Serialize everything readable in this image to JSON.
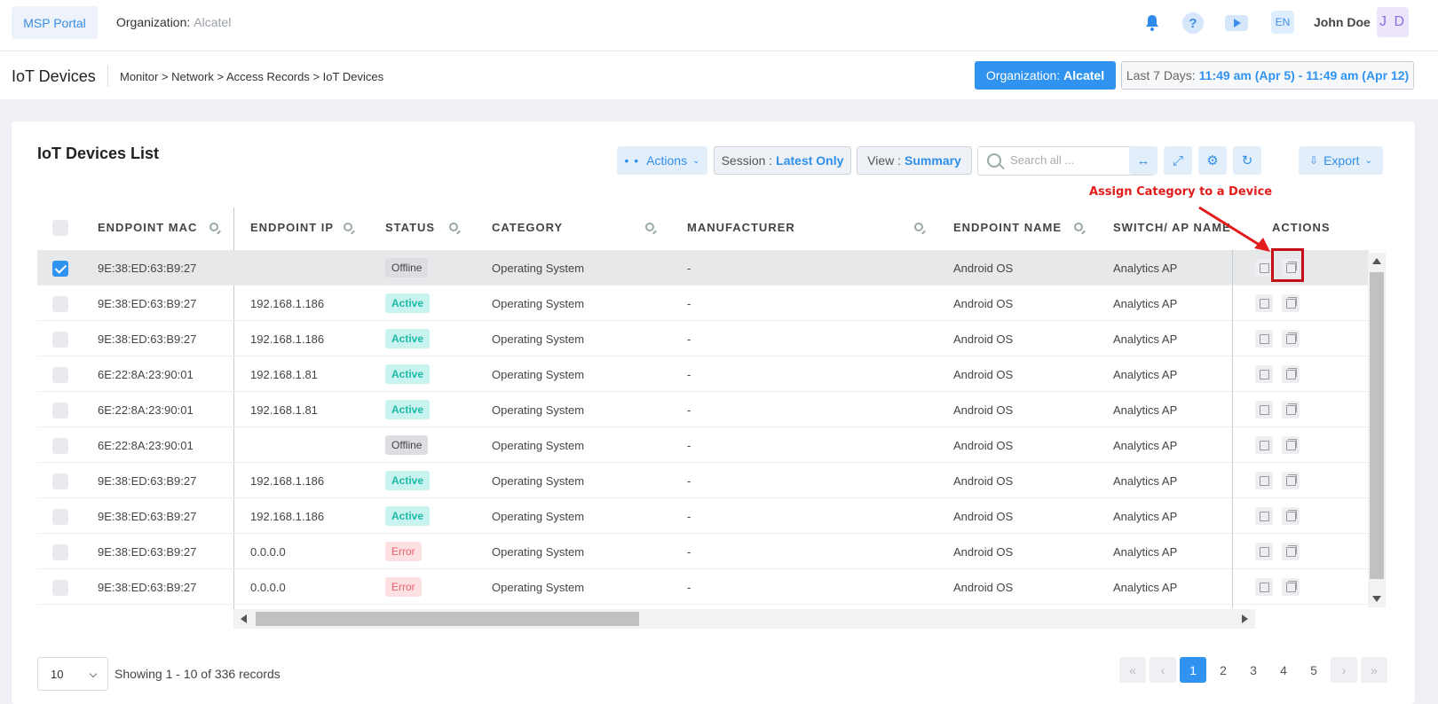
{
  "topbar": {
    "msp_portal": "MSP Portal",
    "org_label": "Organization:",
    "org_value": "Alcatel",
    "lang": "EN",
    "user_name": "John Doe",
    "avatar_initials": "J D"
  },
  "subheader": {
    "title": "IoT Devices",
    "breadcrumb": "Monitor > Network > Access Records > IoT Devices",
    "org_pill_label": "Organization:",
    "org_pill_value": "Alcatel",
    "date_label": "Last 7 Days:",
    "date_value": "11:49 am (Apr 5) - 11:49 am (Apr 12)"
  },
  "card": {
    "title": "IoT Devices List",
    "actions_label": "Actions",
    "session_label": "Session :",
    "session_value": "Latest Only",
    "view_label": "View :",
    "view_value": "Summary",
    "search_placeholder": "Search all ...",
    "export_label": "Export"
  },
  "columns": [
    "ENDPOINT MAC",
    "ENDPOINT IP",
    "STATUS",
    "CATEGORY",
    "MANUFACTURER",
    "ENDPOINT NAME",
    "SWITCH/ AP NAME",
    "ACTIONS"
  ],
  "rows": [
    {
      "mac": "9E:38:ED:63:B9:27",
      "ip": "",
      "status": "Offline",
      "category": "Operating System",
      "manufacturer": "-",
      "name": "Android OS",
      "ap": "Analytics AP",
      "selected": true
    },
    {
      "mac": "9E:38:ED:63:B9:27",
      "ip": "192.168.1.186",
      "status": "Active",
      "category": "Operating System",
      "manufacturer": "-",
      "name": "Android OS",
      "ap": "Analytics AP"
    },
    {
      "mac": "9E:38:ED:63:B9:27",
      "ip": "192.168.1.186",
      "status": "Active",
      "category": "Operating System",
      "manufacturer": "-",
      "name": "Android OS",
      "ap": "Analytics AP"
    },
    {
      "mac": "6E:22:8A:23:90:01",
      "ip": "192.168.1.81",
      "status": "Active",
      "category": "Operating System",
      "manufacturer": "-",
      "name": "Android OS",
      "ap": "Analytics AP"
    },
    {
      "mac": "6E:22:8A:23:90:01",
      "ip": "192.168.1.81",
      "status": "Active",
      "category": "Operating System",
      "manufacturer": "-",
      "name": "Android OS",
      "ap": "Analytics AP"
    },
    {
      "mac": "6E:22:8A:23:90:01",
      "ip": "",
      "status": "Offline",
      "category": "Operating System",
      "manufacturer": "-",
      "name": "Android OS",
      "ap": "Analytics AP"
    },
    {
      "mac": "9E:38:ED:63:B9:27",
      "ip": "192.168.1.186",
      "status": "Active",
      "category": "Operating System",
      "manufacturer": "-",
      "name": "Android OS",
      "ap": "Analytics AP"
    },
    {
      "mac": "9E:38:ED:63:B9:27",
      "ip": "192.168.1.186",
      "status": "Active",
      "category": "Operating System",
      "manufacturer": "-",
      "name": "Android OS",
      "ap": "Analytics AP"
    },
    {
      "mac": "9E:38:ED:63:B9:27",
      "ip": "0.0.0.0",
      "status": "Error",
      "category": "Operating System",
      "manufacturer": "-",
      "name": "Android OS",
      "ap": "Analytics AP"
    },
    {
      "mac": "9E:38:ED:63:B9:27",
      "ip": "0.0.0.0",
      "status": "Error",
      "category": "Operating System",
      "manufacturer": "-",
      "name": "Android OS",
      "ap": "Analytics AP"
    }
  ],
  "annotation": {
    "text": "Assign Category to a Device",
    "color": "#e21b1b"
  },
  "footer": {
    "page_size": "10",
    "showing": "Showing 1 - 10 of 336 records",
    "pages": [
      "1",
      "2",
      "3",
      "4",
      "5"
    ],
    "current_page": "1"
  },
  "colors": {
    "accent": "#2f93ef",
    "active": "#1dbaa8",
    "error": "#e8616b"
  }
}
